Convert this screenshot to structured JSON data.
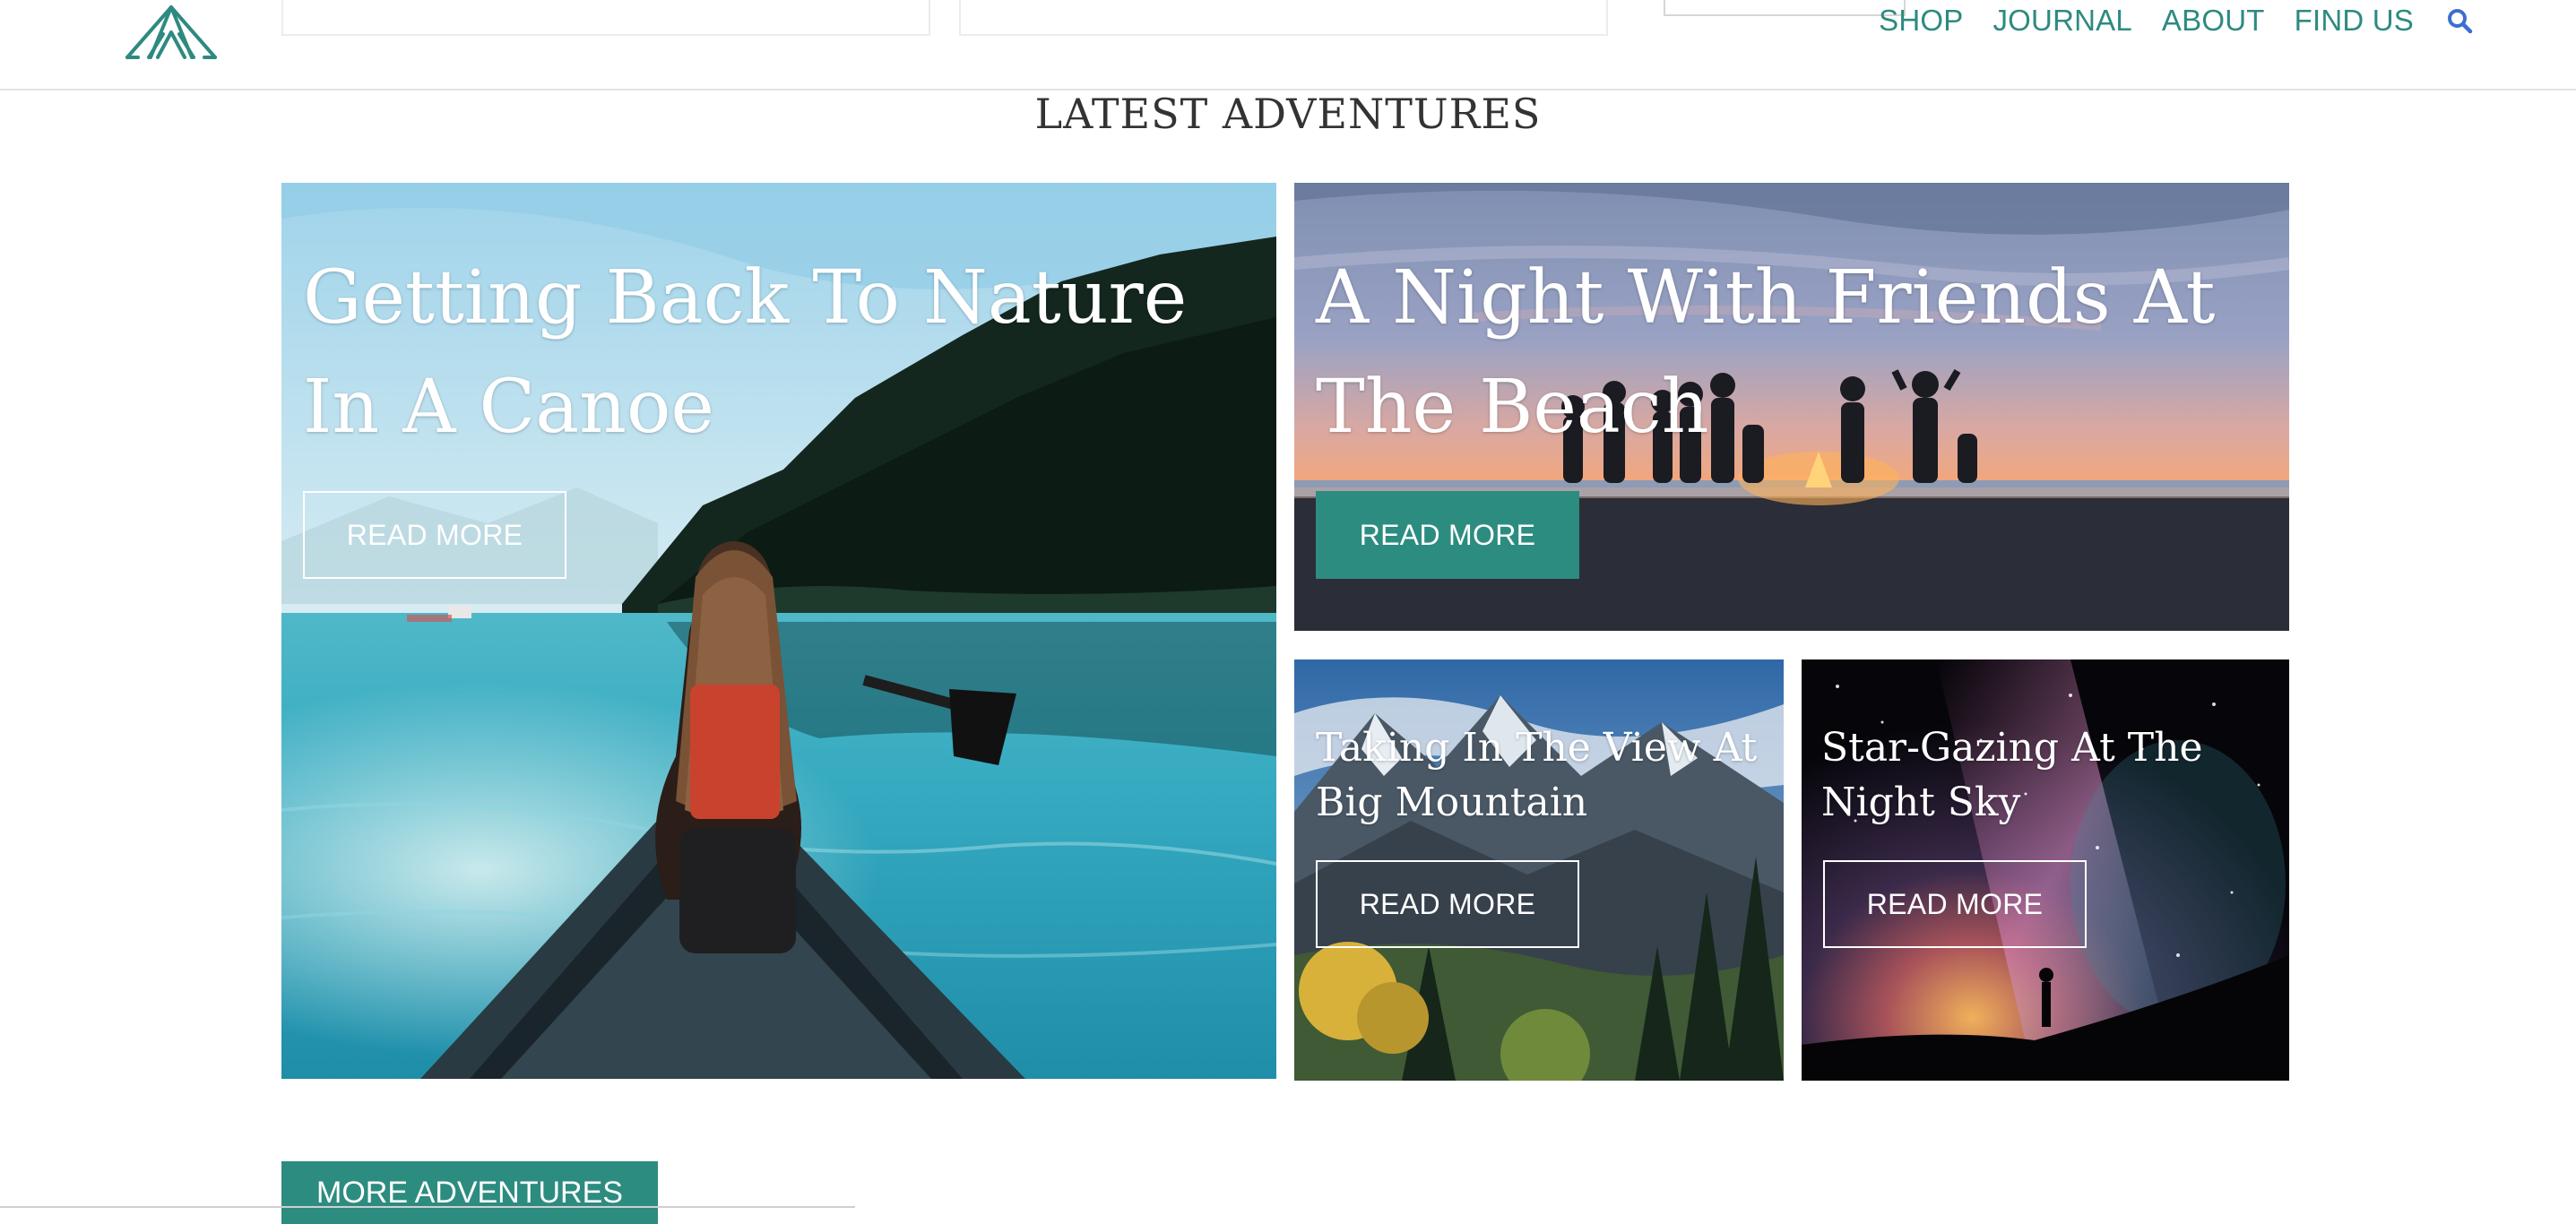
{
  "header": {
    "logo_icon": "tent-icon",
    "nav_items": [
      "SHOP",
      "JOURNAL",
      "ABOUT",
      "FIND US"
    ],
    "search_icon": "search-icon",
    "accent_color": "#2e8a80",
    "search_icon_color": "#3b6fd1"
  },
  "section": {
    "title": "LATEST ADVENTURES"
  },
  "cards": [
    {
      "title": "Getting Back To Nature In A Canoe",
      "button": "READ MORE",
      "button_style": "outline"
    },
    {
      "title": "A Night With Friends At The Beach",
      "button": "READ MORE",
      "button_style": "solid"
    },
    {
      "title": "Taking In The View At Big Mountain",
      "button": "READ MORE",
      "button_style": "outline"
    },
    {
      "title": "Star-Gazing At The Night Sky",
      "button": "READ MORE",
      "button_style": "outline"
    }
  ],
  "more_button": "MORE ADVENTURES",
  "button_color": "#2d8c80"
}
